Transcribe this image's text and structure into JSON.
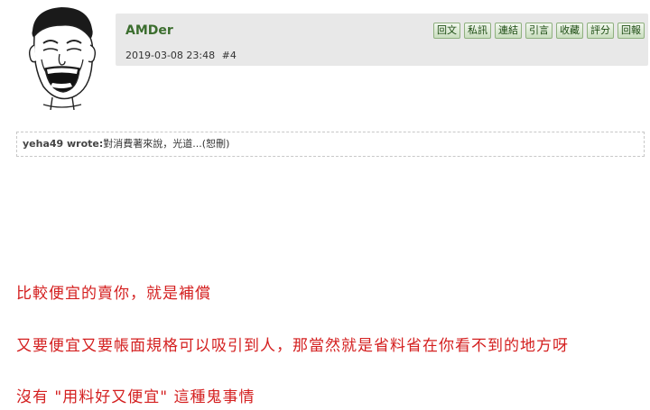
{
  "post": {
    "username": "AMDer",
    "date": "2019-03-08 23:48",
    "floor": "#4"
  },
  "actions": [
    "回文",
    "私訊",
    "連結",
    "引言",
    "收藏",
    "評分",
    "回報"
  ],
  "quote": {
    "author": "yeha49 wrote:",
    "text": "對消費著來說，光道...(恕刪)"
  },
  "body": [
    "比較便宜的賣你，就是補償",
    "又要便宜又要帳面規格可以吸引到人，那當然就是省料省在你看不到的地方呀",
    "沒有 \"用料好又便宜\" 這種鬼事情"
  ]
}
